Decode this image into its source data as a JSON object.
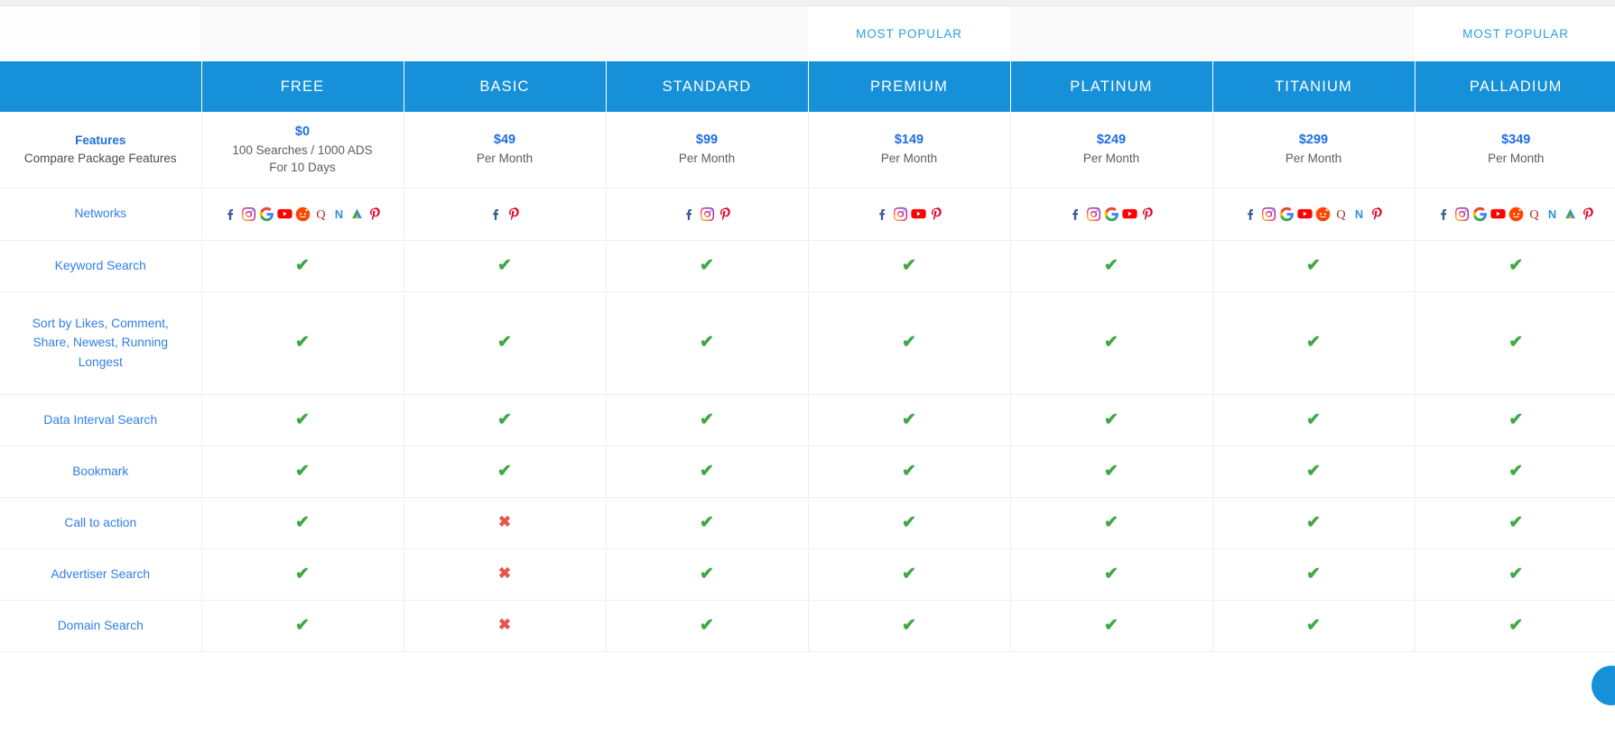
{
  "banner": {
    "most_popular_label": "MOST POPULAR",
    "popular_plans": [
      "PREMIUM",
      "PALLADIUM"
    ]
  },
  "header": {
    "feature_column_label": "",
    "plans": [
      "FREE",
      "BASIC",
      "STANDARD",
      "PREMIUM",
      "PLATINUM",
      "TITANIUM",
      "PALLADIUM"
    ]
  },
  "colors": {
    "brand_blue": "#1690d8",
    "link_blue": "#2f7fe8",
    "price_blue": "#1f6fe0",
    "check_green": "#3fa845",
    "cross_red": "#e2574c",
    "banner_blue": "#2f9ee0"
  },
  "price_row": {
    "feature_title": "Features",
    "feature_subtitle": "Compare Package Features",
    "cells": [
      {
        "amount": "$0",
        "sub1": "100 Searches / 1000 ADS",
        "sub2": "For 10 Days"
      },
      {
        "amount": "$49",
        "sub1": "Per Month",
        "sub2": ""
      },
      {
        "amount": "$99",
        "sub1": "Per Month",
        "sub2": ""
      },
      {
        "amount": "$149",
        "sub1": "Per Month",
        "sub2": ""
      },
      {
        "amount": "$249",
        "sub1": "Per Month",
        "sub2": ""
      },
      {
        "amount": "$299",
        "sub1": "Per Month",
        "sub2": ""
      },
      {
        "amount": "$349",
        "sub1": "Per Month",
        "sub2": ""
      }
    ]
  },
  "networks_row": {
    "label": "Networks",
    "cells": [
      [
        "facebook",
        "instagram",
        "google",
        "youtube",
        "reddit",
        "quora",
        "naver",
        "google-ads",
        "pinterest"
      ],
      [
        "facebook",
        "pinterest"
      ],
      [
        "facebook",
        "instagram",
        "pinterest"
      ],
      [
        "facebook",
        "instagram",
        "youtube",
        "pinterest"
      ],
      [
        "facebook",
        "instagram",
        "google",
        "youtube",
        "pinterest"
      ],
      [
        "facebook",
        "instagram",
        "google",
        "youtube",
        "reddit",
        "quora",
        "naver",
        "pinterest"
      ],
      [
        "facebook",
        "instagram",
        "google",
        "youtube",
        "reddit",
        "quora",
        "naver",
        "google-ads",
        "pinterest"
      ]
    ]
  },
  "feature_rows": [
    {
      "label": "Keyword Search",
      "tall": false,
      "values": [
        "yes",
        "yes",
        "yes",
        "yes",
        "yes",
        "yes",
        "yes"
      ]
    },
    {
      "label": "Sort by Likes, Comment, Share, Newest, Running Longest",
      "tall": true,
      "values": [
        "yes",
        "yes",
        "yes",
        "yes",
        "yes",
        "yes",
        "yes"
      ]
    },
    {
      "label": "Data Interval Search",
      "tall": false,
      "values": [
        "yes",
        "yes",
        "yes",
        "yes",
        "yes",
        "yes",
        "yes"
      ]
    },
    {
      "label": "Bookmark",
      "tall": false,
      "values": [
        "yes",
        "yes",
        "yes",
        "yes",
        "yes",
        "yes",
        "yes"
      ]
    },
    {
      "label": "Call to action",
      "tall": false,
      "values": [
        "yes",
        "no",
        "yes",
        "yes",
        "yes",
        "yes",
        "yes"
      ]
    },
    {
      "label": "Advertiser Search",
      "tall": false,
      "values": [
        "yes",
        "no",
        "yes",
        "yes",
        "yes",
        "yes",
        "yes"
      ]
    },
    {
      "label": "Domain Search",
      "tall": false,
      "values": [
        "yes",
        "no",
        "yes",
        "yes",
        "yes",
        "yes",
        "yes"
      ]
    }
  ],
  "marks": {
    "yes": "✔",
    "no": "✖"
  },
  "chat_widget": {
    "name": "chat-support-bubble"
  }
}
